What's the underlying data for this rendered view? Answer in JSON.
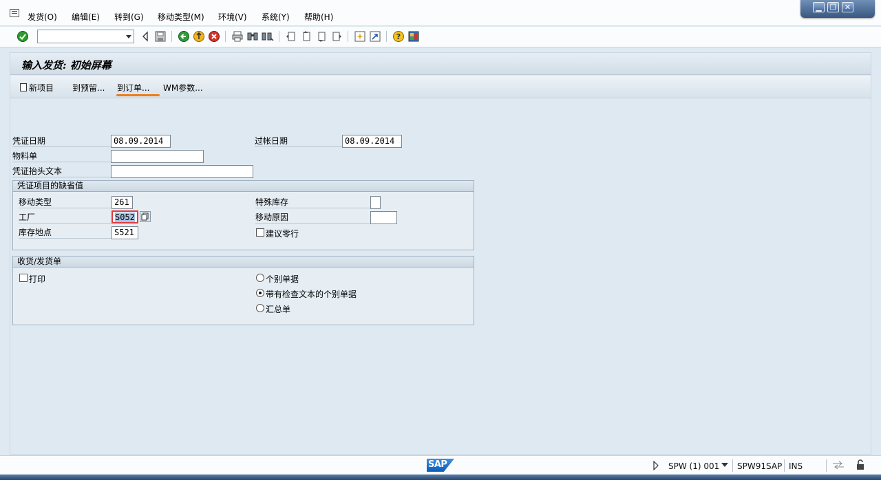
{
  "menu": {
    "items": [
      "发货(O)",
      "编辑(E)",
      "转到(G)",
      "移动类型(M)",
      "环境(V)",
      "系统(Y)",
      "帮助(H)"
    ]
  },
  "window_controls": {
    "minimize": "▁",
    "restore": "❐",
    "close": "✕"
  },
  "toolbar": {
    "icons": [
      "enter-icon",
      "back-icon",
      "save-icon",
      "back-green-icon",
      "exit-icon",
      "cancel-icon",
      "print-icon",
      "find-icon",
      "find-next-icon",
      "first-page-icon",
      "prev-page-icon",
      "next-page-icon",
      "last-page-icon",
      "new-session-icon",
      "shortcut-icon",
      "help-icon",
      "layout-icon"
    ]
  },
  "page": {
    "title": "输入发货: 初始屏幕"
  },
  "app_toolbar": {
    "new_item": "新项目",
    "to_reservation": "到预留...",
    "to_order": "到订单...",
    "wm_params": "WM参数..."
  },
  "header_fields": {
    "doc_date_label": "凭证日期",
    "doc_date_value": "08.09.2014",
    "posting_date_label": "过帐日期",
    "posting_date_value": "08.09.2014",
    "material_slip_label": "物料单",
    "material_slip_value": "",
    "header_text_label": "凭证抬头文本",
    "header_text_value": ""
  },
  "defaults_group": {
    "title": "凭证项目的缺省值",
    "movement_type_label": "移动类型",
    "movement_type_value": "261",
    "plant_label": "工厂",
    "plant_value": "S052",
    "storage_location_label": "库存地点",
    "storage_location_value": "S521",
    "special_stock_label": "特殊库存",
    "special_stock_value": "",
    "reason_label": "移动原因",
    "reason_value": "",
    "suggest_zero_label": "建议零行"
  },
  "slip_group": {
    "title": "收货/发货单",
    "print_label": "打印",
    "individual_slip": "个别单据",
    "individual_with_text": "带有检查文本的个别单据",
    "collective_slip": "汇总单"
  },
  "status_bar": {
    "logo": "SAP",
    "session": "SPW (1) 001",
    "server": "SPW91SAP",
    "mode": "INS"
  },
  "colors": {
    "background": "#dfe9f1",
    "accent_underline": "#f07b16",
    "field_focus_border": "#e23b3b"
  }
}
